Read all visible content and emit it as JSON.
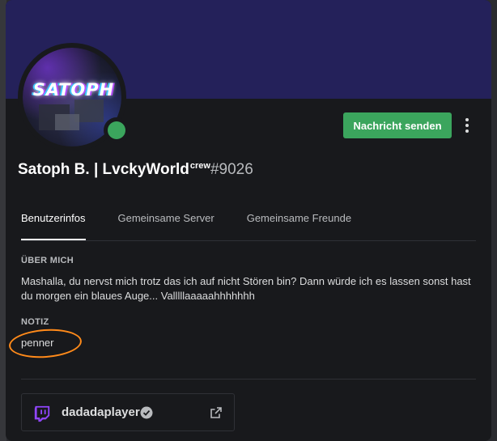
{
  "profile": {
    "avatar_text": "SATOPH",
    "status": "online",
    "display_name": "Satoph B. | LvckyWorld",
    "name_suffix": "crew",
    "discriminator": "#9026",
    "send_message_label": "Nachricht senden"
  },
  "tabs": [
    {
      "label": "Benutzerinfos",
      "active": true
    },
    {
      "label": "Gemeinsame Server",
      "active": false
    },
    {
      "label": "Gemeinsame Freunde",
      "active": false
    }
  ],
  "about": {
    "title": "ÜBER MICH",
    "text": "Mashalla, du nervst mich trotz das ich auf nicht Stören bin? Dann würde ich es lassen sonst hast du morgen ein blaues Auge... Valllllaaaaahhhhhhh"
  },
  "note": {
    "title": "NOTIZ",
    "value": "penner"
  },
  "connection": {
    "service_icon": "twitch-icon",
    "name": "dadadaplayer",
    "verified": true
  },
  "colors": {
    "banner": "#24215a",
    "online": "#3ba55d",
    "send_button": "#3ba55d",
    "twitch": "#9146ff",
    "annotation": "#ff8a1a"
  }
}
